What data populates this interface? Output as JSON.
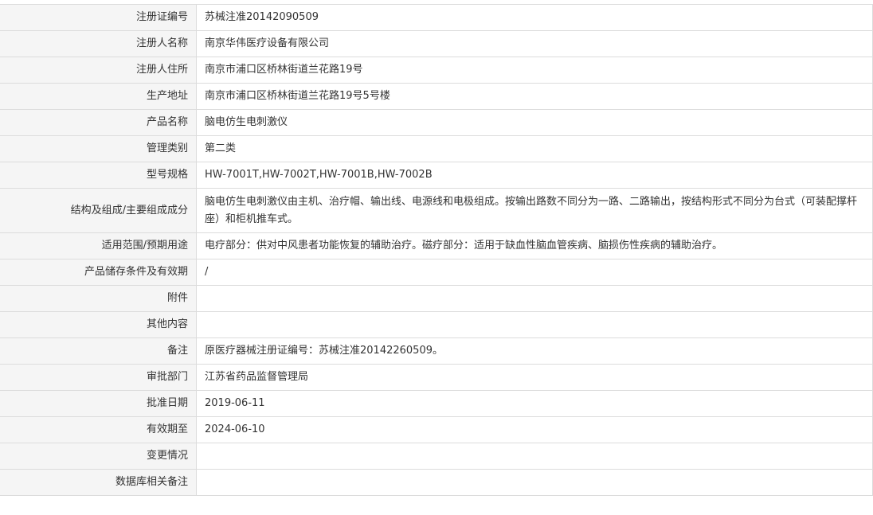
{
  "rows": [
    {
      "label": "注册证编号",
      "value": "苏械注准20142090509"
    },
    {
      "label": "注册人名称",
      "value": "南京华伟医疗设备有限公司"
    },
    {
      "label": "注册人住所",
      "value": "南京市浦口区桥林街道兰花路19号"
    },
    {
      "label": "生产地址",
      "value": "南京市浦口区桥林街道兰花路19号5号楼"
    },
    {
      "label": "产品名称",
      "value": "脑电仿生电刺激仪"
    },
    {
      "label": "管理类别",
      "value": "第二类"
    },
    {
      "label": "型号规格",
      "value": "HW-7001T,HW-7002T,HW-7001B,HW-7002B"
    },
    {
      "label": "结构及组成/主要组成成分",
      "value": "脑电仿生电刺激仪由主机、治疗帽、输出线、电源线和电极组成。按输出路数不同分为一路、二路输出，按结构形式不同分为台式（可装配撑杆座）和柜机推车式。"
    },
    {
      "label": "适用范围/预期用途",
      "value": "电疗部分：供对中风患者功能恢复的辅助治疗。磁疗部分：适用于缺血性脑血管疾病、脑损伤性疾病的辅助治疗。"
    },
    {
      "label": "产品储存条件及有效期",
      "value": "/"
    },
    {
      "label": "附件",
      "value": ""
    },
    {
      "label": "其他内容",
      "value": ""
    },
    {
      "label": "备注",
      "value": "原医疗器械注册证编号：苏械注准20142260509。"
    },
    {
      "label": "审批部门",
      "value": "江苏省药品监督管理局"
    },
    {
      "label": "批准日期",
      "value": "2019-06-11"
    },
    {
      "label": "有效期至",
      "value": "2024-06-10"
    },
    {
      "label": "变更情况",
      "value": ""
    },
    {
      "label": "数据库相关备注",
      "value": ""
    }
  ]
}
